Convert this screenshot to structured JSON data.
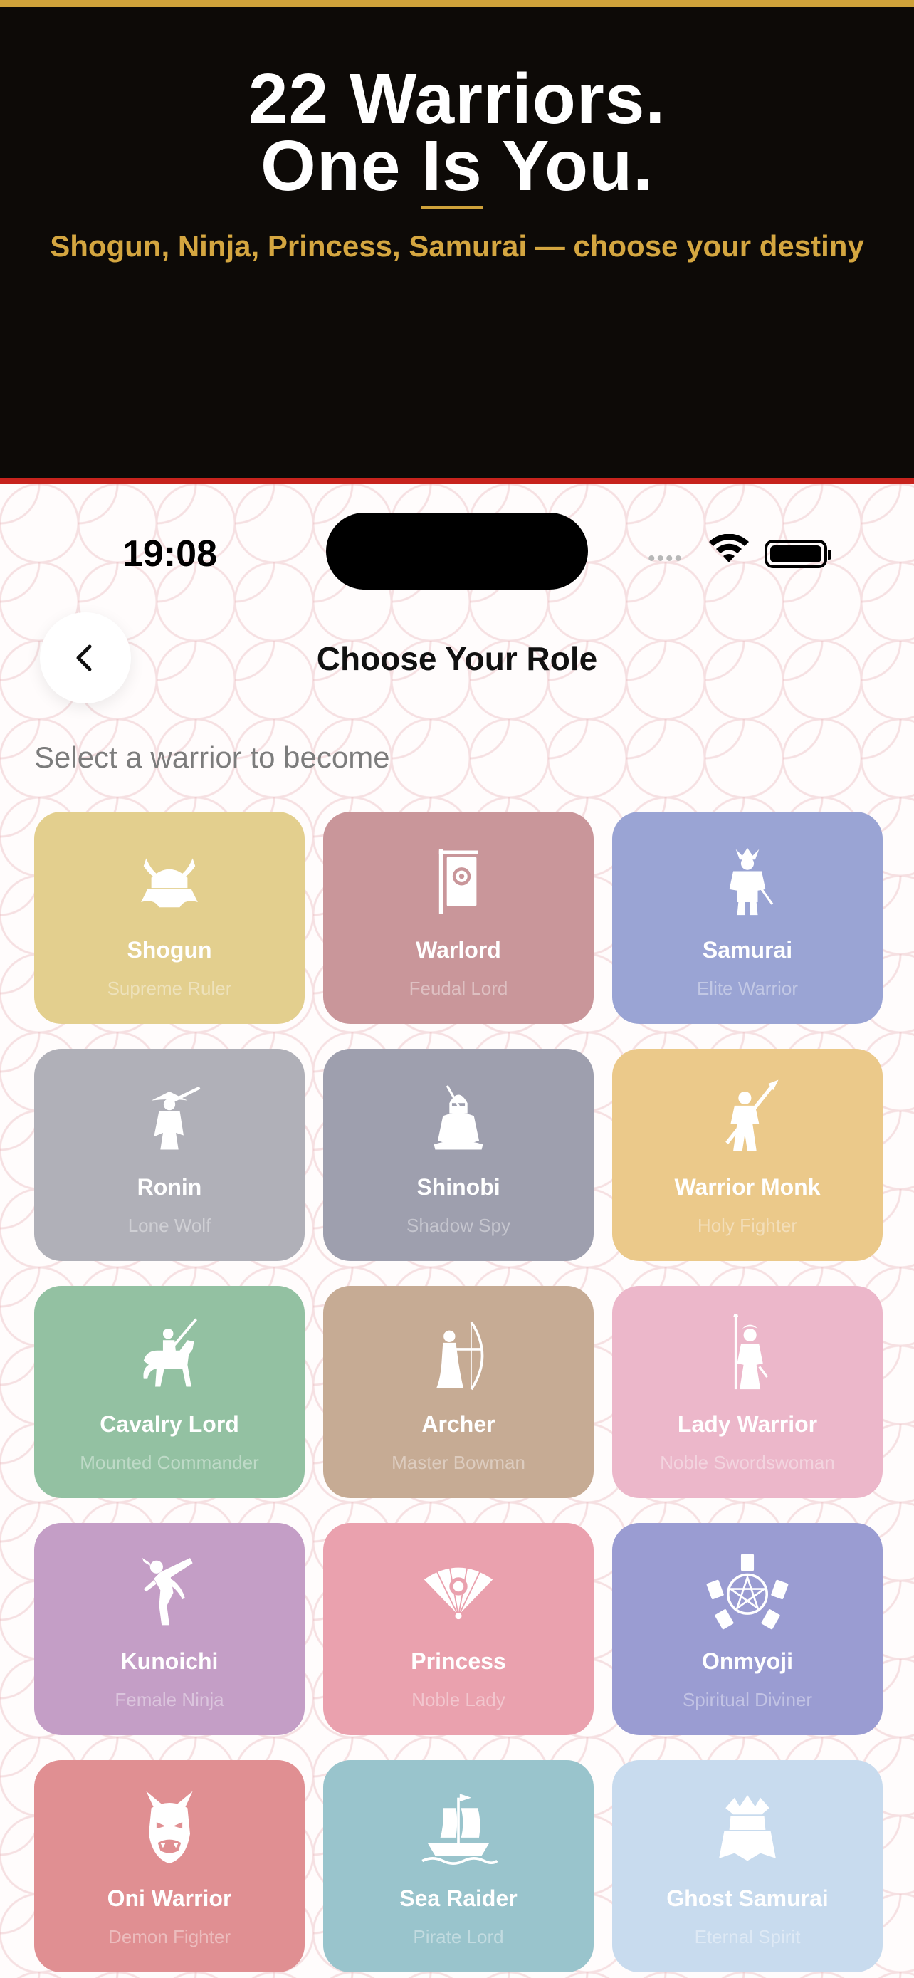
{
  "promo": {
    "headline_line1": "22 Warriors.",
    "headline_line2_a": "One",
    "headline_line2_b": "Is",
    "headline_line2_c": "You.",
    "subtitle": "Shogun, Ninja, Princess, Samurai — choose your destiny",
    "colors": {
      "background": "#0d0a07",
      "gold": "#cfa23a",
      "red": "#c7231d"
    }
  },
  "status_bar": {
    "time": "19:08",
    "signal_icon": "signal-dots-icon",
    "wifi_icon": "wifi-icon",
    "battery_icon": "battery-full-icon"
  },
  "nav": {
    "back_icon": "chevron-left-icon",
    "title": "Choose Your Role"
  },
  "instruction": "Select a warrior to become",
  "roles": [
    {
      "name": "Shogun",
      "desc": "Supreme Ruler",
      "color": "#e3cf8e",
      "icon": "kabuto-helmet-icon"
    },
    {
      "name": "Warlord",
      "desc": "Feudal Lord",
      "color": "#c9969a",
      "icon": "war-banner-icon"
    },
    {
      "name": "Samurai",
      "desc": "Elite Warrior",
      "color": "#9aa4d4",
      "icon": "armored-samurai-icon"
    },
    {
      "name": "Ronin",
      "desc": "Lone Wolf",
      "color": "#b0b0b8",
      "icon": "straw-hat-swordsman-icon"
    },
    {
      "name": "Shinobi",
      "desc": "Shadow Spy",
      "color": "#9e9fae",
      "icon": "hooded-ninja-icon"
    },
    {
      "name": "Warrior Monk",
      "desc": "Holy Fighter",
      "color": "#ebc98a",
      "icon": "naginata-monk-icon"
    },
    {
      "name": "Cavalry Lord",
      "desc": "Mounted Commander",
      "color": "#93c1a2",
      "icon": "horse-rider-icon"
    },
    {
      "name": "Archer",
      "desc": "Master Bowman",
      "color": "#c6ab94",
      "icon": "bow-archer-icon"
    },
    {
      "name": "Lady Warrior",
      "desc": "Noble Swordswoman",
      "color": "#ecb7ca",
      "icon": "naginata-lady-icon"
    },
    {
      "name": "Kunoichi",
      "desc": "Female Ninja",
      "color": "#c49ec6",
      "icon": "kicking-ninja-icon"
    },
    {
      "name": "Princess",
      "desc": "Noble Lady",
      "color": "#eaa1ae",
      "icon": "folding-fan-icon"
    },
    {
      "name": "Onmyoji",
      "desc": "Spiritual Diviner",
      "color": "#9a9cd2",
      "icon": "pentagram-seal-icon"
    },
    {
      "name": "Oni Warrior",
      "desc": "Demon Fighter",
      "color": "#e08f92",
      "icon": "oni-mask-icon"
    },
    {
      "name": "Sea Raider",
      "desc": "Pirate Lord",
      "color": "#99c4cc",
      "icon": "sailing-ship-icon"
    },
    {
      "name": "Ghost Samurai",
      "desc": "Eternal Spirit",
      "color": "#c8dbee",
      "icon": "ghost-samurai-icon"
    }
  ]
}
